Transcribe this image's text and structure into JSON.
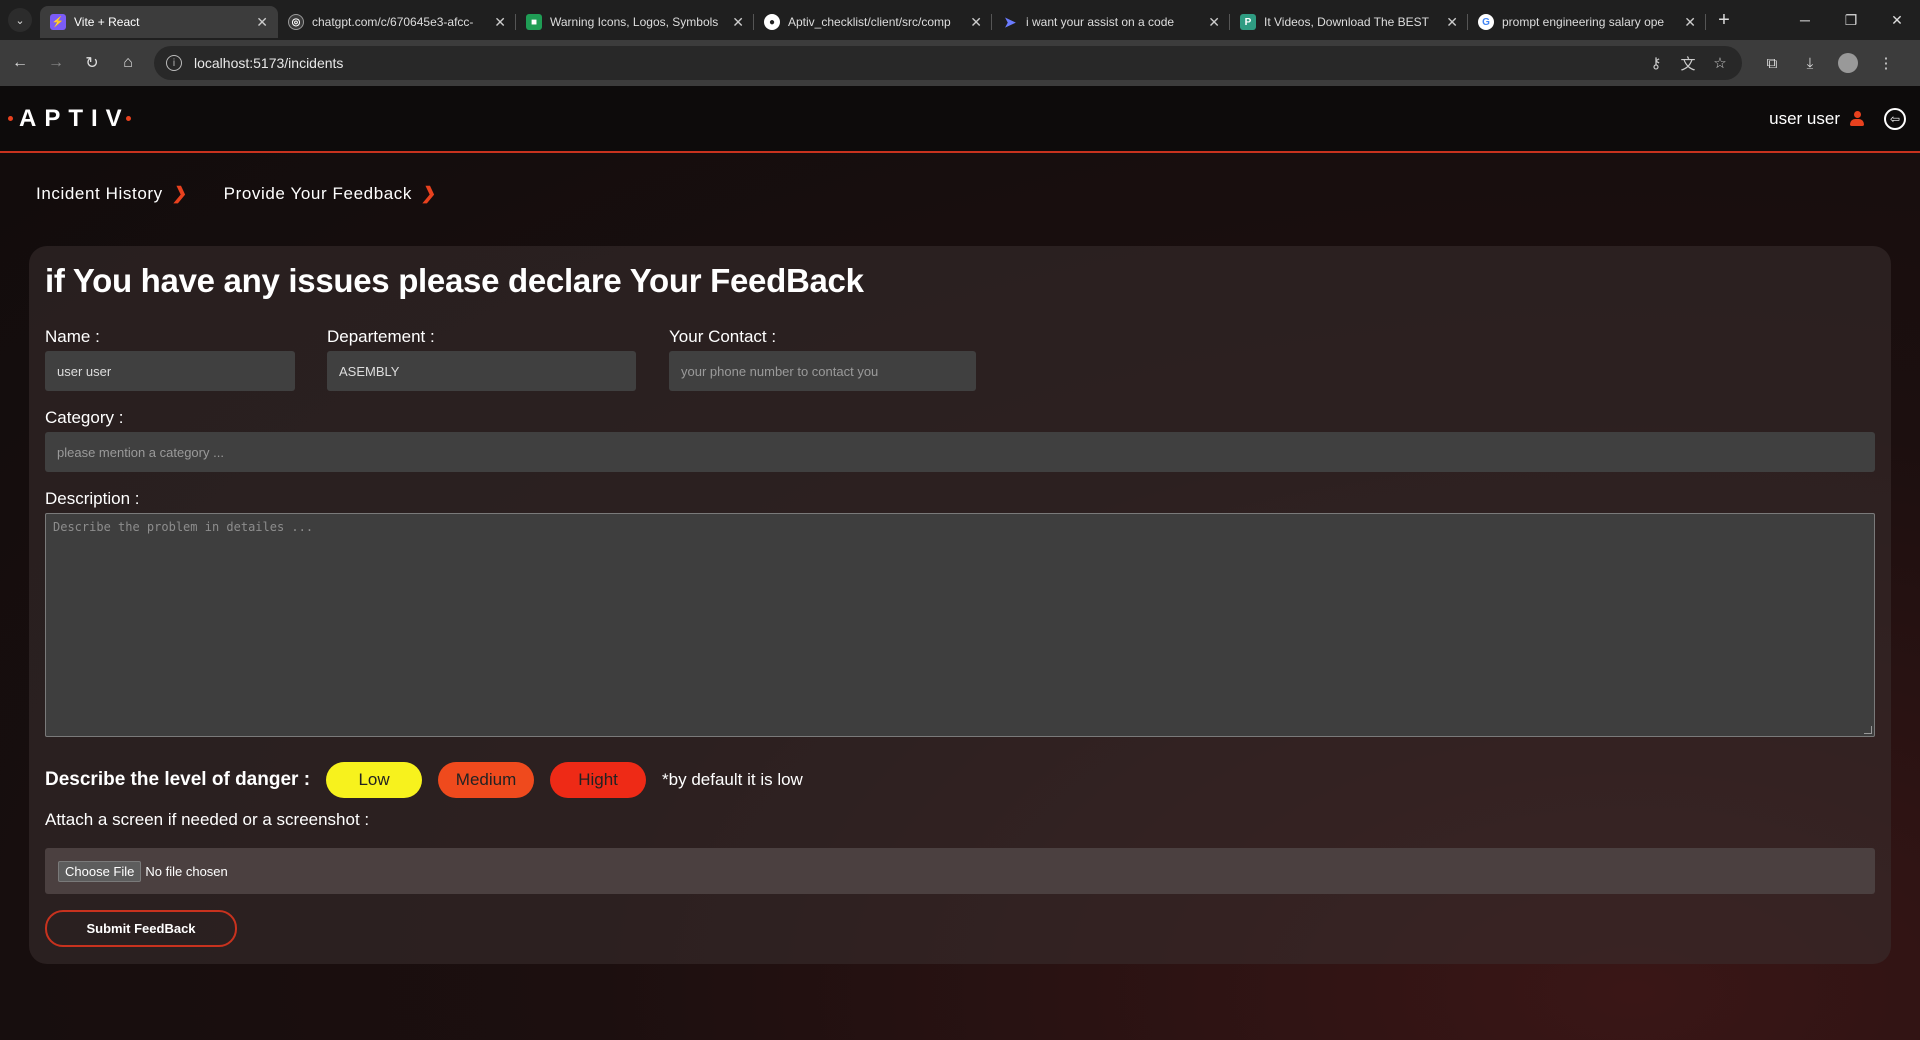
{
  "browser": {
    "tabs": [
      {
        "title": "Vite + React",
        "favicon": "vite-icon",
        "color": "#7b5cf6",
        "active": true
      },
      {
        "title": "chatgpt.com/c/670645e3-afcc-",
        "favicon": "chatgpt-icon",
        "color": "#3a3a3a"
      },
      {
        "title": "Warning Icons, Logos, Symbols",
        "favicon": "flaticon-icon",
        "color": "#1f9d55"
      },
      {
        "title": "Aptiv_checklist/client/src/comp",
        "favicon": "github-icon",
        "color": "#222222"
      },
      {
        "title": "i want your assist on a code",
        "favicon": "assistant-icon",
        "color": "#4b5cf0"
      },
      {
        "title": "It Videos, Download The BEST",
        "favicon": "video-site-icon",
        "color": "#2f9c82"
      },
      {
        "title": "prompt engineering salary ope",
        "favicon": "google-icon",
        "color": "#ffffff"
      }
    ],
    "url": "localhost:5173/incidents"
  },
  "header": {
    "logo": "APTIV",
    "username": "user user"
  },
  "subnav": [
    {
      "label": "Incident History"
    },
    {
      "label": "Provide Your Feedback"
    }
  ],
  "form": {
    "title": "if You have any issues please declare Your FeedBack",
    "name_label": "Name :",
    "name_value": "user user",
    "department_label": "Departement :",
    "department_value": "ASEMBLY",
    "contact_label": "Your Contact :",
    "contact_placeholder": "your phone number to contact you",
    "category_label": "Category :",
    "category_placeholder": "please mention a category ...",
    "description_label": "Description :",
    "description_placeholder": "Describe the problem in detailes ...",
    "danger_label": "Describe the level of danger :",
    "danger_levels": [
      "Low",
      "Medium",
      "Hight"
    ],
    "danger_note": "*by default it is low",
    "attach_label": "Attach a screen if needed or a screenshot :",
    "file_button": "Choose File",
    "file_status": "No file chosen",
    "submit_label": "Submit FeedBack"
  },
  "colors": {
    "accent": "#e8411e",
    "low": "#f7f21d",
    "medium": "#ef4a1d",
    "high": "#ee2a16"
  }
}
